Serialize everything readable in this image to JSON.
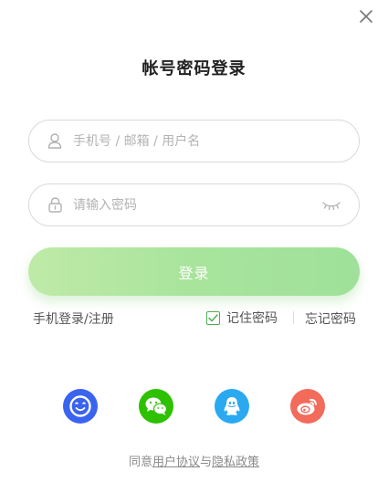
{
  "dialog": {
    "title": "帐号密码登录",
    "close_icon": "close-icon"
  },
  "account": {
    "placeholder": "手机号 / 邮箱 / 用户名",
    "value": "",
    "icon": "user-icon"
  },
  "password": {
    "placeholder": "请输入密码",
    "value": "",
    "icon": "lock-icon",
    "toggle_icon": "eye-closed-icon"
  },
  "login_button": {
    "label": "登录",
    "color_start": "#bfeaa8",
    "color_end": "#9fe19a"
  },
  "links": {
    "phone_login": "手机登录/注册",
    "remember_label": "记住密码",
    "remember_checked": true,
    "forgot": "忘记密码"
  },
  "social_logins": [
    {
      "icon": "app-icon",
      "color": "#3a63f0"
    },
    {
      "icon": "wechat-icon",
      "color": "#2dc100"
    },
    {
      "icon": "qq-icon",
      "color": "#2aa9f0"
    },
    {
      "icon": "weibo-icon",
      "color": "#f26b5b"
    }
  ],
  "agreement": {
    "prefix": "同意",
    "user_agreement": "用户协议",
    "joiner": "与",
    "privacy_policy": "隐私政策"
  }
}
